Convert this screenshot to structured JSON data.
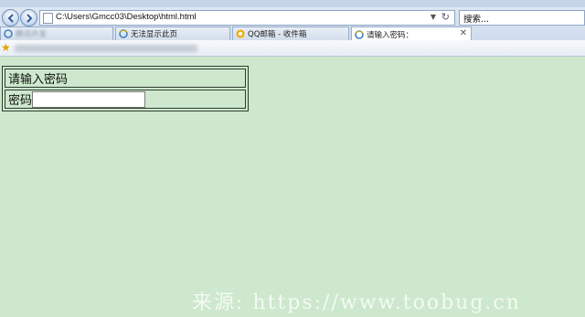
{
  "browser": {
    "address": "C:\\Users\\Gmcc03\\Desktop\\html.html",
    "search_placeholder": "搜索...",
    "tabs": [
      {
        "label": "腾讯开发",
        "active": false,
        "icon": "ie-icon"
      },
      {
        "label": "无法显示此页",
        "active": false,
        "icon": "ie-icon"
      },
      {
        "label": "QQ邮箱 - 收件箱",
        "active": false,
        "icon": "qq-mail-icon"
      },
      {
        "label": "请输入密码：",
        "active": true,
        "icon": "ie-icon"
      }
    ]
  },
  "page": {
    "title_row": "请输入密码",
    "password_label": "密码",
    "password_value": ""
  },
  "watermark": "来源: https://www.toobug.cn",
  "colors": {
    "page_background": "#cde8cc",
    "table_border": "#2e3b2e"
  }
}
